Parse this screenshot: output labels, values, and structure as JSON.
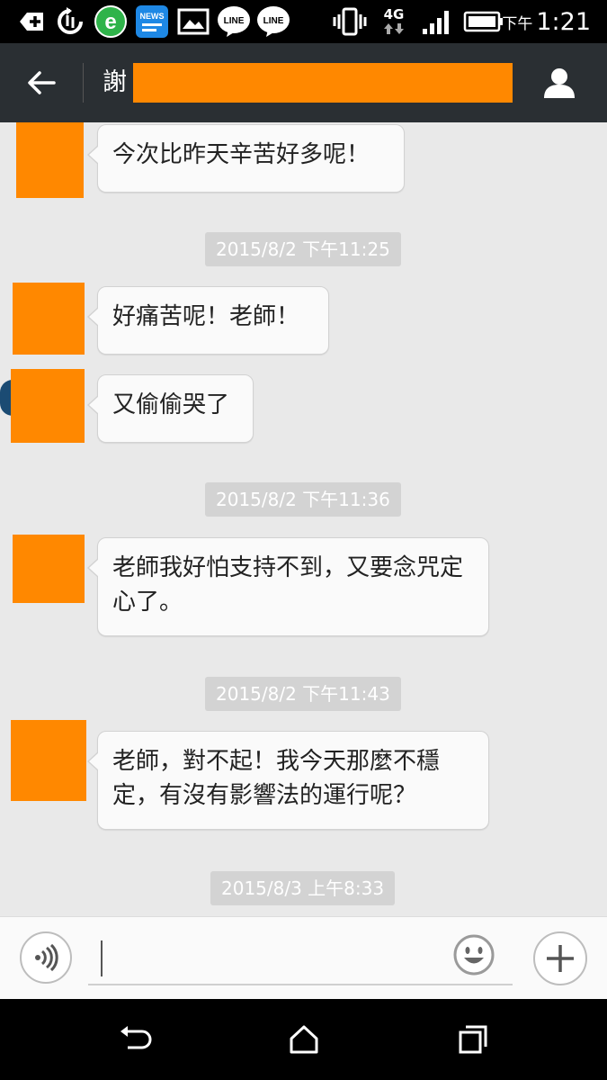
{
  "status_bar": {
    "time_ampm": "下午",
    "time": "1:21",
    "network": "4G",
    "icons": [
      "add-icon",
      "sync-icon",
      "browser-icon",
      "news-app-icon",
      "picture-icon",
      "line-app-icon",
      "line-app-icon",
      "vibrate-icon",
      "network-4g-icon",
      "signal-icon",
      "battery-icon"
    ],
    "news_label": "NEWS",
    "line_label": "LINE"
  },
  "header": {
    "contact_name_visible": "謝",
    "back_icon": "arrow-left-icon",
    "profile_icon": "person-icon"
  },
  "messages": [
    {
      "type": "text",
      "text": "今次比昨天辛苦好多呢！"
    },
    {
      "type": "timestamp",
      "text": "2015/8/2 下午11:25"
    },
    {
      "type": "text",
      "text": "好痛苦呢！老師！"
    },
    {
      "type": "text",
      "text": "又偷偷哭了"
    },
    {
      "type": "timestamp",
      "text": "2015/8/2 下午11:36"
    },
    {
      "type": "text",
      "text": "老師我好怕支持不到，又要念咒定心了。"
    },
    {
      "type": "timestamp",
      "text": "2015/8/2 下午11:43"
    },
    {
      "type": "text",
      "text": "老師，對不起！我今天那麼不穩定，有沒有影響法的運行呢？"
    },
    {
      "type": "timestamp",
      "text": "2015/8/3 上午8:33"
    }
  ],
  "input_bar": {
    "placeholder": "",
    "value": "",
    "voice_icon": "voice-wave-icon",
    "emoji_icon": "smiley-icon",
    "plus_icon": "plus-icon"
  },
  "nav_bar": {
    "icons": [
      "back-icon",
      "home-icon",
      "recent-apps-icon"
    ]
  },
  "colors": {
    "header_bg": "#2a2f33",
    "chat_bg": "#e9e9e9",
    "redaction": "#ff8800",
    "timestamp_bg": "#d3d3d3"
  }
}
